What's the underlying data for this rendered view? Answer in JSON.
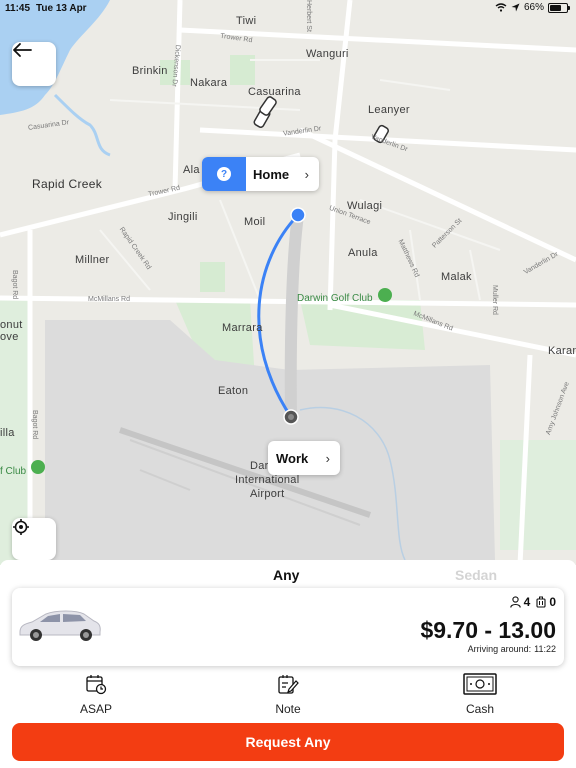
{
  "status_bar": {
    "time": "11:45",
    "date": "Tue 13 Apr",
    "battery": "66%",
    "battery_level": 0.66
  },
  "map": {
    "places": {
      "tiwi": "Tiwi",
      "wanguri": "Wanguri",
      "brinkin": "Brinkin",
      "nakara": "Nakara",
      "casuarina": "Casuarina",
      "leanyer": "Leanyer",
      "rapid_creek": "Rapid Creek",
      "alawa": "Ala",
      "jingili": "Jingili",
      "moil": "Moil",
      "wulagi": "Wulagi",
      "anula": "Anula",
      "millner": "Millner",
      "malak": "Malak",
      "marrara": "Marrara",
      "karama": "Karan",
      "coconut_grove_1": "onut",
      "coconut_grove_2": "ove",
      "eaton": "Eaton",
      "ludmilla": "illa",
      "airport_1": "Dar",
      "airport_2": "International",
      "airport_3": "Airport"
    },
    "streets": {
      "herbert": "Herbert St",
      "trower_top": "Trower Rd",
      "casuarina_dr": "Casuarina Dr",
      "vanderlin_1": "Vanderlin Dr",
      "vanderlin_2": "Vanderlin Dr",
      "vanderlin_3": "Vanderlin Dr",
      "trower_left": "Trower Rd",
      "union": "Union Terrace",
      "rapid_creek_rd": "Rapid Creek Rd",
      "bagot": "Bagot Rd",
      "bagot_2": "Bagot Rd",
      "mcmillans": "McMillans Rd",
      "mcmillans_2": "McMillans Rd",
      "matthews": "Matthews Rd",
      "patterson": "Patterson St",
      "muller": "Muller Rd",
      "amy_johnson": "Amy Johnson Ave",
      "dickenson": "Dickenson Dr"
    },
    "golf": {
      "darwin": "Darwin Golf Club",
      "other": "f Club"
    },
    "home_callout": {
      "label": "Home",
      "icon": "?"
    },
    "work_callout": {
      "label": "Work"
    }
  },
  "sheet": {
    "tabs": {
      "any": "Any",
      "sedan": "Sedan"
    },
    "vehicle": {
      "passengers": "4",
      "luggage": "0",
      "price": "$9.70 - 13.00",
      "arrival_label": "Arriving around:",
      "arrival_time": "11:22"
    },
    "options": {
      "asap": "ASAP",
      "note": "Note",
      "cash": "Cash"
    },
    "request_label": "Request Any"
  },
  "colors": {
    "accent": "#f33d12",
    "route": "#3b82f6",
    "home_badge": "#3b82f6"
  }
}
